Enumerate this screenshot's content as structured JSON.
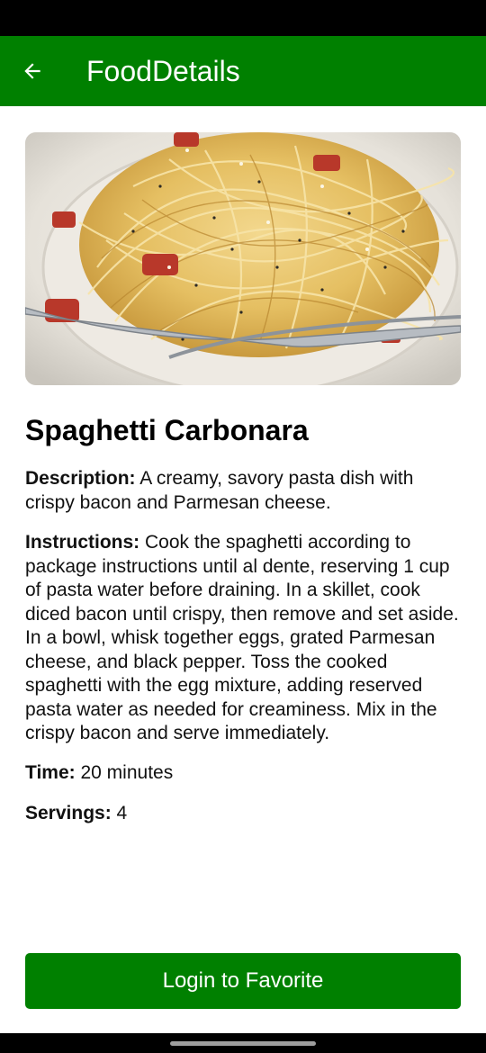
{
  "app_bar": {
    "title": "FoodDetails",
    "back_icon": "arrow-left-icon",
    "background": "#008000"
  },
  "hero_image": {
    "subject": "spaghetti-carbonara-photo"
  },
  "food": {
    "name": "Spaghetti Carbonara",
    "description_label": "Description:",
    "description": "A creamy, savory pasta dish with crispy bacon and Parmesan cheese.",
    "instructions_label": "Instructions:",
    "instructions": "Cook the spaghetti according to package instructions until al dente, reserving 1 cup of pasta water before draining. In a skillet, cook diced bacon until crispy, then remove and set aside. In a bowl, whisk together eggs, grated Parmesan cheese, and black pepper. Toss the cooked spaghetti with the egg mixture, adding reserved pasta water as needed for creaminess. Mix in the crispy bacon and serve immediately.",
    "time_label": "Time:",
    "time": "20 minutes",
    "servings_label": "Servings:",
    "servings": "4"
  },
  "actions": {
    "favorite_label": "Login to Favorite",
    "accent": "#008000"
  }
}
